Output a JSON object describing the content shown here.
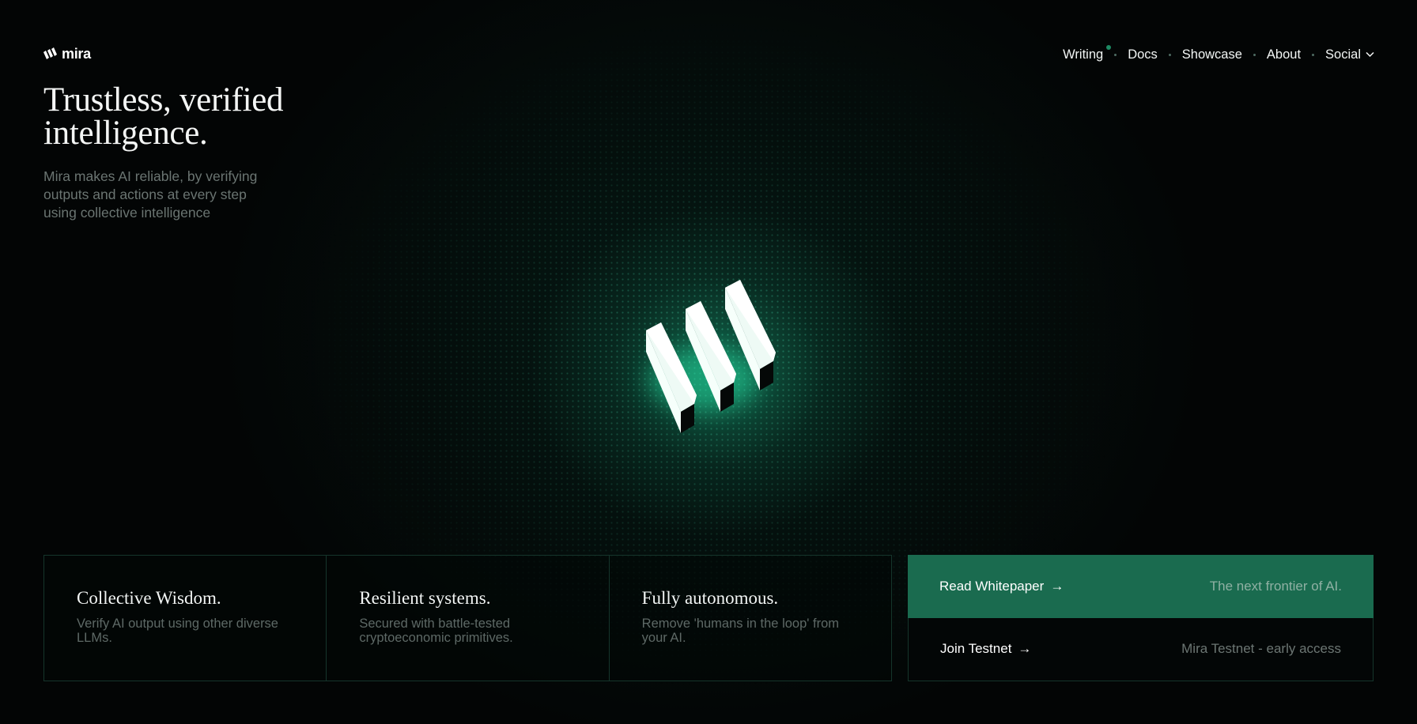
{
  "brand": {
    "name": "mira",
    "accent_color": "#1a6b4f"
  },
  "nav": {
    "items": [
      {
        "label": "Writing",
        "has_indicator": true
      },
      {
        "label": "Docs"
      },
      {
        "label": "Showcase"
      },
      {
        "label": "About"
      },
      {
        "label": "Social",
        "icon": "chevron-down-icon"
      }
    ]
  },
  "hero": {
    "title": "Trustless, verified intelligence.",
    "subtitle": "Mira makes AI reliable, by verifying outputs and actions at every step using collective intelligence"
  },
  "features": [
    {
      "title": "Collective Wisdom.",
      "description": "Verify AI output using other diverse LLMs."
    },
    {
      "title": "Resilient systems.",
      "description": "Secured with battle-tested cryptoeconomic primitives."
    },
    {
      "title": "Fully autonomous.",
      "description": "Remove 'humans in the loop' from your AI."
    }
  ],
  "cta": {
    "primary": {
      "label": "Read Whitepaper",
      "arrow": "→",
      "note": "The next frontier of AI."
    },
    "secondary": {
      "label": "Join Testnet",
      "arrow": "→",
      "note": "Mira Testnet - early access"
    }
  }
}
